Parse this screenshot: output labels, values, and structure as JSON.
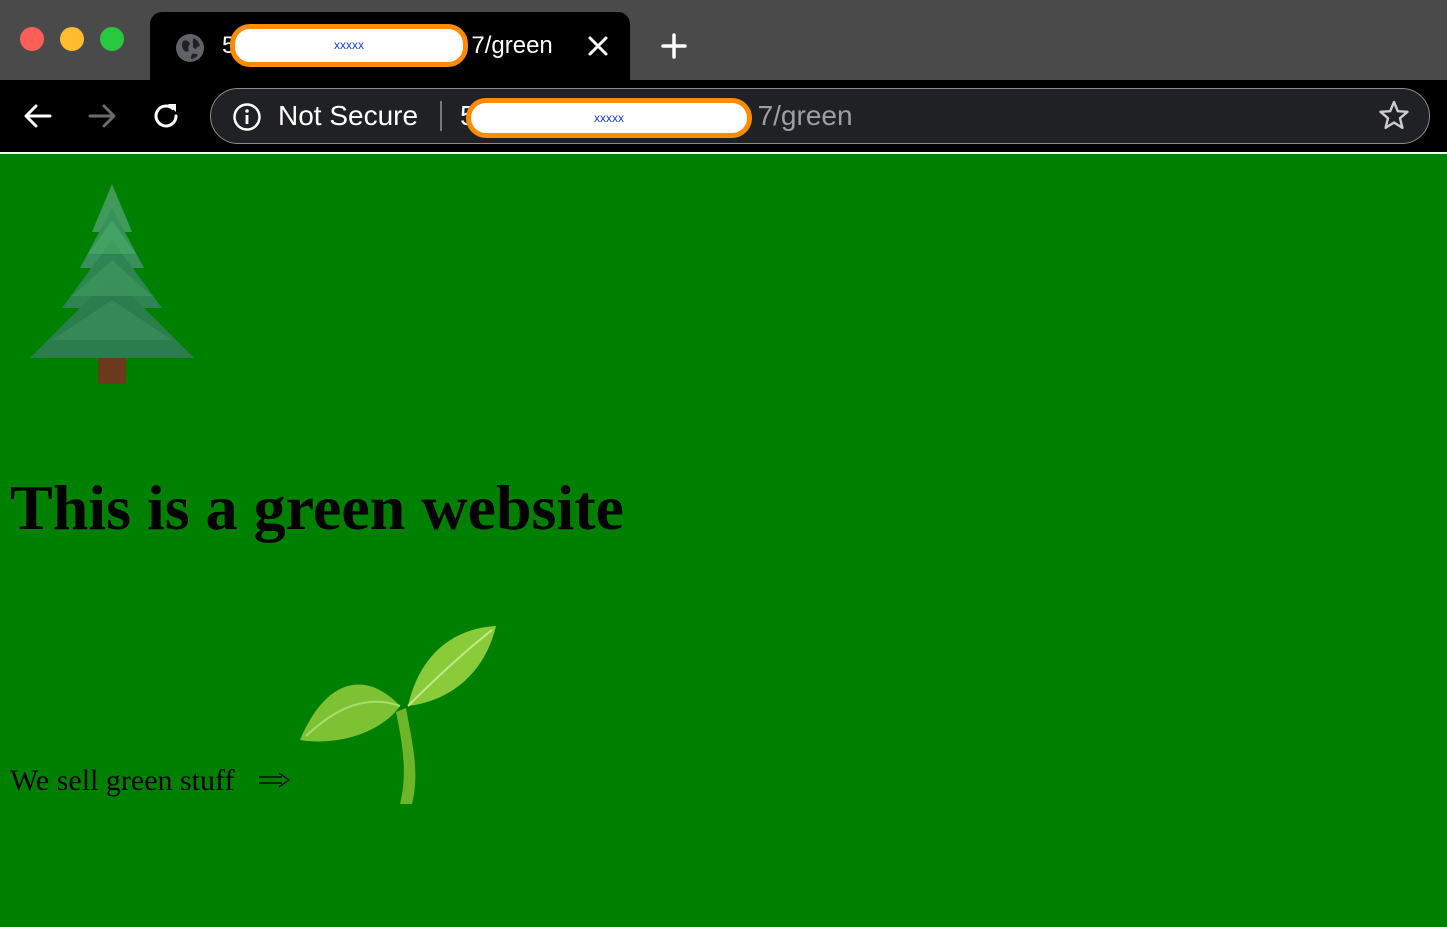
{
  "browser": {
    "window_controls": [
      "close",
      "minimize",
      "maximize"
    ],
    "tab": {
      "title_prefix": "5",
      "title_redacted": "xxxxx",
      "title_suffix": "7/green",
      "favicon": "globe-icon",
      "close_icon": "close-icon"
    },
    "new_tab_icon": "plus-icon",
    "address_bar": {
      "security_label": "Not Secure",
      "url_prefix": "5",
      "url_redacted": "xxxxx",
      "url_suffix": "7/green",
      "bookmark_icon": "star-icon"
    },
    "nav_icons": [
      "back-arrow-icon",
      "forward-arrow-icon",
      "reload-icon"
    ]
  },
  "page": {
    "background_color": "#008000",
    "hero_image": "evergreen-tree-emoji",
    "heading": "This is a green website",
    "tagline": "We sell green stuff",
    "tagline_arrow": "long-right-arrow-icon",
    "product_image": "seedling-emoji"
  },
  "colors": {
    "page_bg": "#008000",
    "redaction_border": "#ff8c00",
    "redaction_text": "#1a3fd6"
  }
}
